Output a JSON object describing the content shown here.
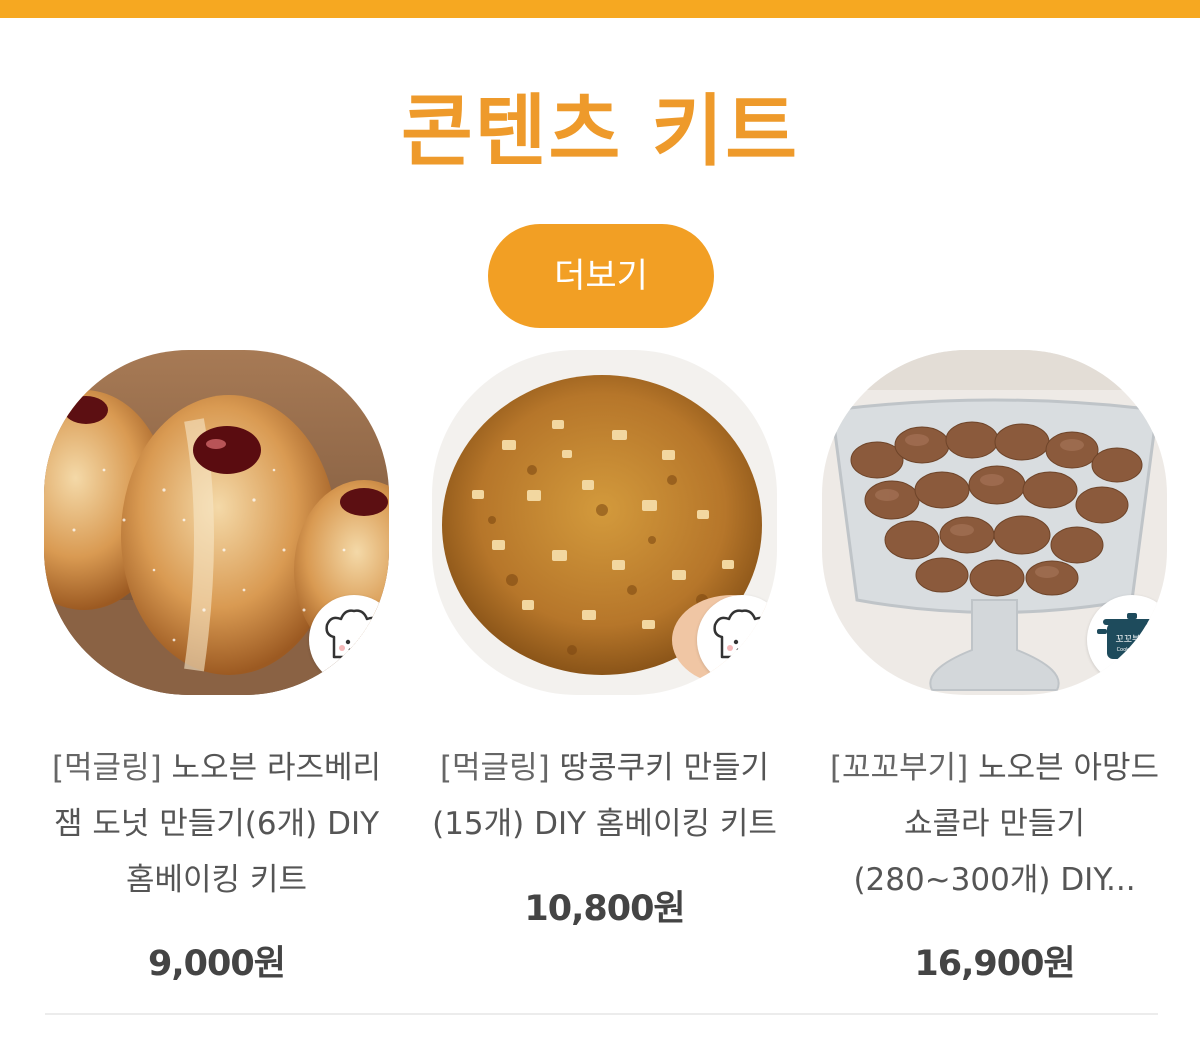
{
  "section": {
    "title": "콘텐츠 키트",
    "more_label": "더보기"
  },
  "products": [
    {
      "brand": "[먹글링]",
      "name_lines": [
        "노오븐 라즈베리",
        "잼 도넛 만들기(6개) DIY",
        "홈베이킹 키트"
      ],
      "price": "9,000원",
      "image_icon": "jam-donut-image",
      "badge_icon": "chef-hat-logo"
    },
    {
      "brand": "[먹글링]",
      "name_lines": [
        "땅콩쿠키 만들기",
        "(15개) DIY 홈베이킹 키트"
      ],
      "price": "10,800원",
      "image_icon": "peanut-cookie-image",
      "badge_icon": "chef-hat-logo"
    },
    {
      "brand": "[꼬꼬부기]",
      "name_lines": [
        "노오븐 아망드",
        "쇼콜라 만들기",
        "(280~300개) DIY..."
      ],
      "price": "16,900원",
      "image_icon": "almond-chocolate-image",
      "badge_icon": "pot-logo",
      "badge_text": "꼬꼬부기",
      "badge_subtext": "Cooking Lab"
    }
  ],
  "colors": {
    "accent_bar": "#f6a821",
    "title": "#ee9a2b",
    "button_bg": "#f29f24",
    "badge_pot": "#1e4b5c"
  }
}
